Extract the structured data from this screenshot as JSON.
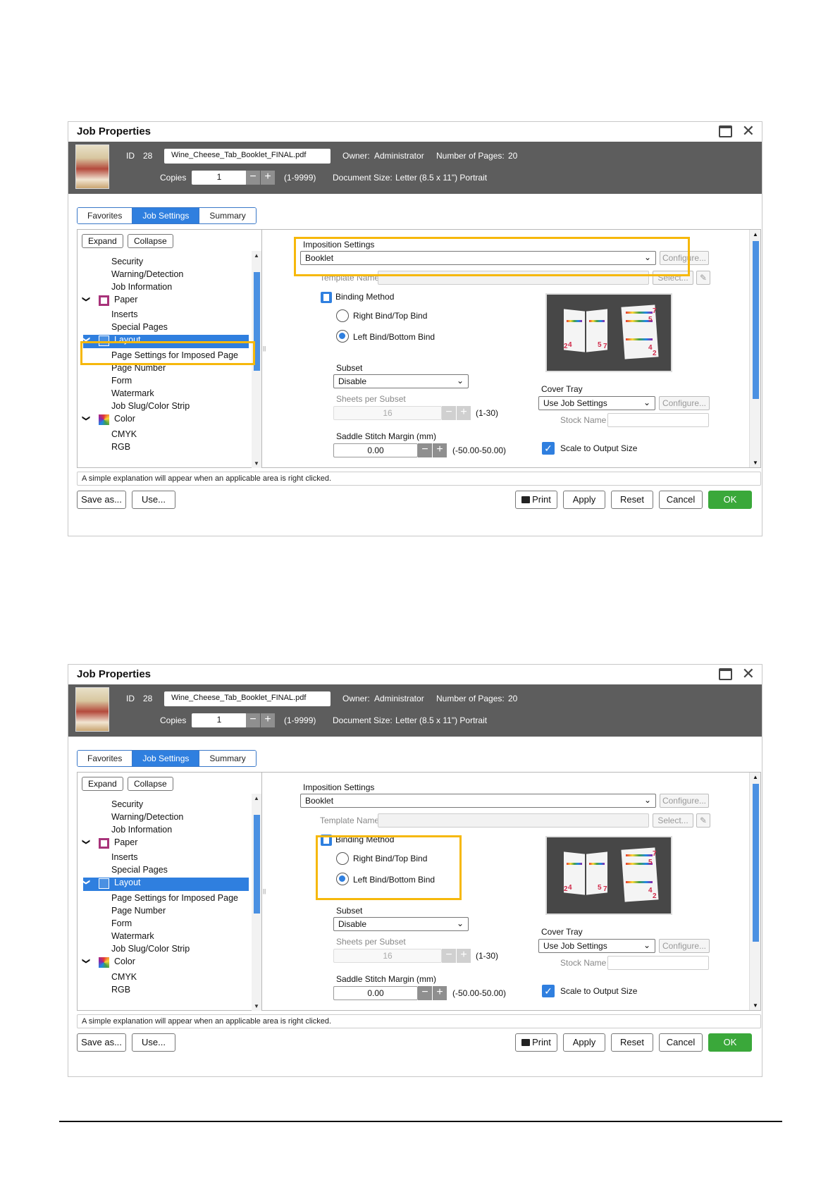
{
  "dialog": {
    "title": "Job Properties",
    "info": {
      "id_label": "ID",
      "id_value": "28",
      "filename": "Wine_Cheese_Tab_Booklet_FINAL.pdf",
      "owner_label": "Owner:",
      "owner_value": "Administrator",
      "pages_label": "Number of Pages:",
      "pages_value": "20",
      "copies_label": "Copies",
      "copies_value": "1",
      "copies_range": "(1-9999)",
      "docsize_label": "Document Size:",
      "docsize_value": "Letter (8.5 x 11\") Portrait"
    },
    "tabs": [
      "Favorites",
      "Job Settings",
      "Summary"
    ],
    "tree": {
      "expand": "Expand",
      "collapse": "Collapse",
      "items": [
        "Security",
        "Warning/Detection",
        "Job Information"
      ],
      "paper": "Paper",
      "paper_items": [
        "Inserts",
        "Special Pages"
      ],
      "layout": "Layout",
      "layout_items": [
        "Page Settings for Imposed Page",
        "Page Number",
        "Form",
        "Watermark",
        "Job Slug/Color Strip"
      ],
      "color": "Color",
      "color_items": [
        "CMYK",
        "RGB"
      ]
    },
    "settings": {
      "imposition_label": "Imposition Settings",
      "imposition_value": "Booklet",
      "configure": "Configure...",
      "template_label": "Template Name",
      "select": "Select...",
      "binding_label": "Binding Method",
      "binding_opt1": "Right Bind/Top Bind",
      "binding_opt2": "Left Bind/Bottom Bind",
      "subset_label": "Subset",
      "subset_value": "Disable",
      "sheets_label": "Sheets per Subset",
      "sheets_value": "16",
      "sheets_range": "(1-30)",
      "saddle_label": "Saddle Stitch Margin (mm)",
      "saddle_value": "0.00",
      "saddle_range": "(-50.00-50.00)",
      "cover_label": "Cover Tray",
      "cover_value": "Use Job Settings",
      "stock_label": "Stock Name",
      "scale_label": "Scale to Output Size",
      "preview_pages": [
        "2",
        "4",
        "5",
        "7",
        "7",
        "5",
        "4",
        "2"
      ]
    },
    "status": "A simple explanation will appear when an applicable area is right clicked.",
    "buttons": {
      "save_as": "Save as...",
      "use": "Use...",
      "print": "Print",
      "apply": "Apply",
      "reset": "Reset",
      "cancel": "Cancel",
      "ok": "OK"
    }
  },
  "colors": {
    "accent_blue": "#2f7fdf",
    "header_gray": "#5d5d5d",
    "highlight": "#f6b80b",
    "ok_green": "#3aa83a"
  }
}
